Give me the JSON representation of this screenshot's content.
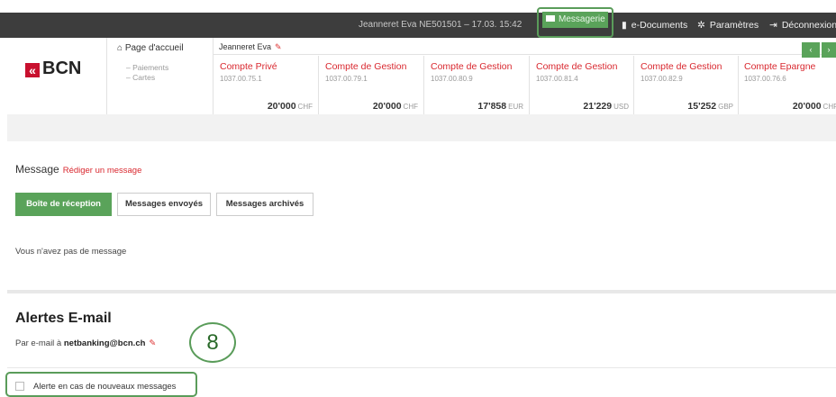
{
  "topbar": {
    "user_info": "Jeanneret Eva   NE501501 – 17.03. 15:42",
    "messagerie": "Messagerie",
    "edocuments": "e-Documents",
    "parametres": "Paramètres",
    "deconnexion": "Déconnexion"
  },
  "header": {
    "logo": "BCN",
    "home": "Page d'accueil",
    "sub_items": [
      "– Paiements",
      "– Cartes"
    ],
    "owner": "Jeanneret Eva",
    "accounts": [
      {
        "name": "Compte Privé",
        "number": "1037.00.75.1",
        "amount": "20'000",
        "currency": "CHF"
      },
      {
        "name": "Compte de Gestion",
        "number": "1037.00.79.1",
        "amount": "20'000",
        "currency": "CHF"
      },
      {
        "name": "Compte de Gestion",
        "number": "1037.00.80.9",
        "amount": "17'858",
        "currency": "EUR"
      },
      {
        "name": "Compte de Gestion",
        "number": "1037.00.81.4",
        "amount": "21'229",
        "currency": "USD"
      },
      {
        "name": "Compte de Gestion",
        "number": "1037.00.82.9",
        "amount": "15'252",
        "currency": "GBP"
      },
      {
        "name": "Compte Epargne",
        "number": "1037.00.76.6",
        "amount": "20'000",
        "currency": "CHF"
      }
    ],
    "prev_arrow": "‹",
    "next_arrow": "›"
  },
  "messages": {
    "title": "Message",
    "compose_link": "Rédiger un message",
    "tabs": [
      "Boîte de réception",
      "Messages envoyés",
      "Messages archivés"
    ],
    "empty_text": "Vous n'avez pas de message"
  },
  "alerts": {
    "title": "Alertes E-mail",
    "email_prefix": "Par e-mail à",
    "email": "netbanking@bcn.ch",
    "step_badge": "8",
    "checkbox_label": "Alerte en cas de nouveaux messages"
  },
  "colors": {
    "accent_green": "#5aa35a",
    "brand_red": "#d9282f",
    "topbar": "#3d3d3d"
  }
}
